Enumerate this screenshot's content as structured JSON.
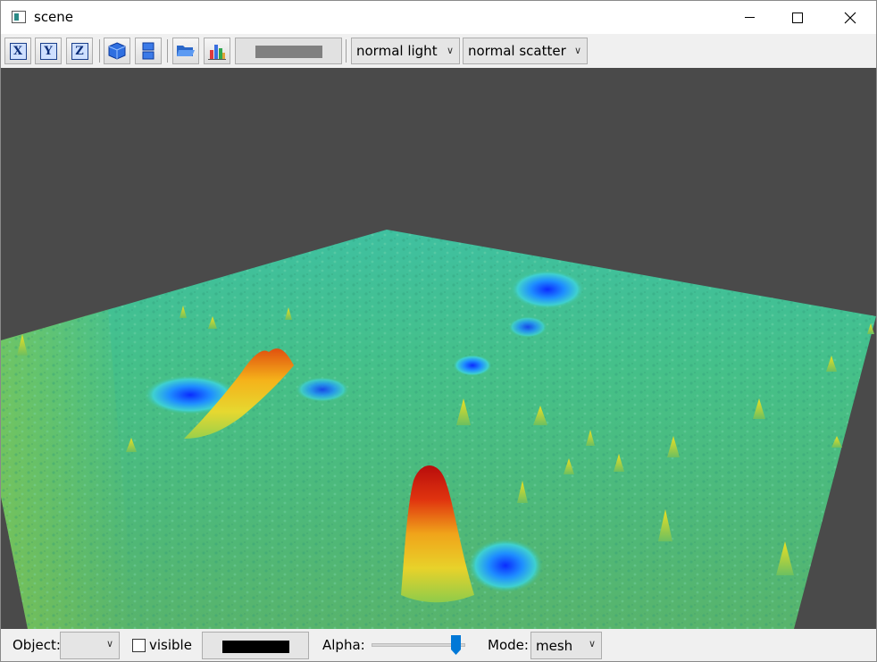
{
  "window": {
    "title": "scene"
  },
  "toolbar": {
    "x_axis_label": "X",
    "y_axis_label": "Y",
    "z_axis_label": "Z",
    "light_select": "normal light",
    "scatter_select": "normal scatter",
    "color_swatch": "#808080"
  },
  "bottom": {
    "object_label": "Object:",
    "object_value": "",
    "visible_label": "visible",
    "visible_checked": false,
    "color_swatch": "#000000",
    "alpha_label": "Alpha:",
    "alpha_value": 0.9,
    "mode_label": "Mode:",
    "mode_value": "mesh"
  },
  "viewport": {
    "background": "#4a4a4a",
    "surface_colormap": [
      "#0a2cff",
      "#1ea0ff",
      "#3fd0b0",
      "#46c27a",
      "#b5d94a",
      "#f5d020",
      "#f07a10",
      "#c80e0e"
    ]
  }
}
